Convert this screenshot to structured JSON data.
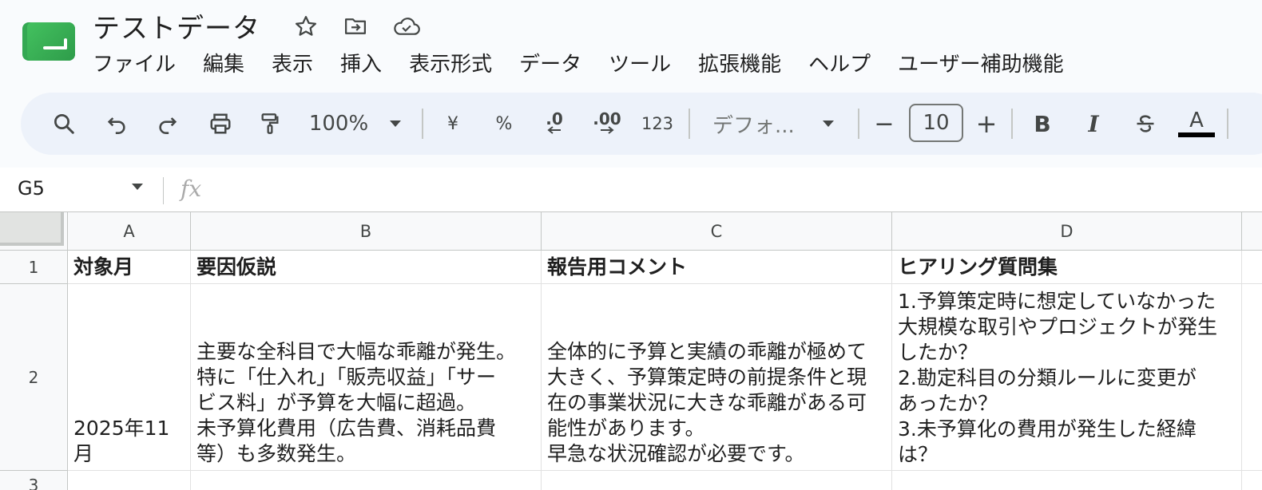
{
  "header": {
    "doc_title": "テストデータ",
    "menu": [
      "ファイル",
      "編集",
      "表示",
      "挿入",
      "表示形式",
      "データ",
      "ツール",
      "拡張機能",
      "ヘルプ",
      "ユーザー補助機能"
    ]
  },
  "toolbar": {
    "zoom": "100%",
    "currency": "¥",
    "percent": "%",
    "decrease_decimal": ".0",
    "increase_decimal": ".00",
    "number_format": "123",
    "font": "デフォ...",
    "font_size": "10",
    "minus": "−",
    "plus": "+",
    "bold": "B",
    "italic": "I",
    "text_color": "A"
  },
  "formula_bar": {
    "name_box": "G5",
    "fx_label": "fx",
    "content": ""
  },
  "grid": {
    "columns": [
      "A",
      "B",
      "C",
      "D"
    ],
    "rows": [
      "1",
      "2",
      "3"
    ],
    "row1": {
      "A": "対象月",
      "B": "要因仮説",
      "C": "報告用コメント",
      "D": "ヒアリング質問集"
    },
    "row2": {
      "A": "2025年11月",
      "B": "主要な全科目で大幅な乖離が発生。\n特に「仕入れ」「販売収益」「サー\nビス料」が予算を大幅に超過。\n未予算化費用（広告費、消耗品費\n等）も多数発生。",
      "C": "全体的に予算と実績の乖離が極めて\n大きく、予算策定時の前提条件と現\n在の事業状況に大きな乖離がある可\n能性があります。\n早急な状況確認が必要です。",
      "D": "1.予算策定時に想定していなかった\n大規模な取引やプロジェクトが発生\nしたか？\n2.勘定科目の分類ルールに変更が\nあったか？\n3.未予算化の費用が発生した経緯\nは？"
    }
  },
  "colors": {
    "background": "#f9fbfd",
    "toolbar": "#edf2fa",
    "logo_green": "#34a853",
    "header_gray": "#f8f9fa"
  }
}
